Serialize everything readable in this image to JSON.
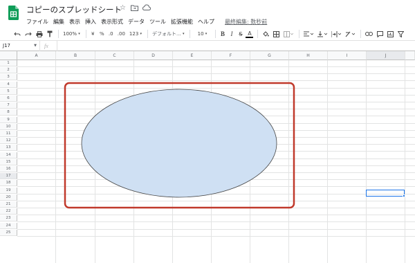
{
  "title": {
    "doc_title": "コピーのスプレッドシート",
    "icons": [
      "star-icon",
      "move-to-folder-icon",
      "cloud-status-icon"
    ]
  },
  "menu": {
    "items": [
      "ファイル",
      "編集",
      "表示",
      "挿入",
      "表示形式",
      "データ",
      "ツール",
      "拡張機能",
      "ヘルプ"
    ],
    "last_edit": "最終編集: 数秒前"
  },
  "toolbar": {
    "zoom": "100%",
    "currency": "¥",
    "percent": "%",
    "decimal_decrease": ".0",
    "decimal_increase": ".00",
    "more_formats": "123",
    "font": "デフォルト...",
    "font_size": "10",
    "bold": "B",
    "italic": "I",
    "strike": "S",
    "text_color": "A"
  },
  "formula_bar": {
    "cell_ref": "J17",
    "fx": "fx"
  },
  "grid": {
    "columns": [
      "A",
      "B",
      "C",
      "D",
      "E",
      "F",
      "G",
      "H",
      "I",
      "J"
    ],
    "rows": [
      "1",
      "2",
      "3",
      "4",
      "5",
      "6",
      "7",
      "8",
      "9",
      "10",
      "11",
      "12",
      "13",
      "14",
      "15",
      "16",
      "17",
      "18",
      "19",
      "20",
      "21",
      "22",
      "23",
      "24",
      "25"
    ],
    "selected_column": "J",
    "selected_row": "17"
  },
  "shape": {
    "type": "ellipse",
    "fill": "#cfe0f3",
    "stroke": "#444444"
  },
  "highlight": {
    "color": "#c0392b"
  },
  "colors": {
    "sheets_green": "#0f9d58",
    "selection_blue": "#1a73e8"
  }
}
